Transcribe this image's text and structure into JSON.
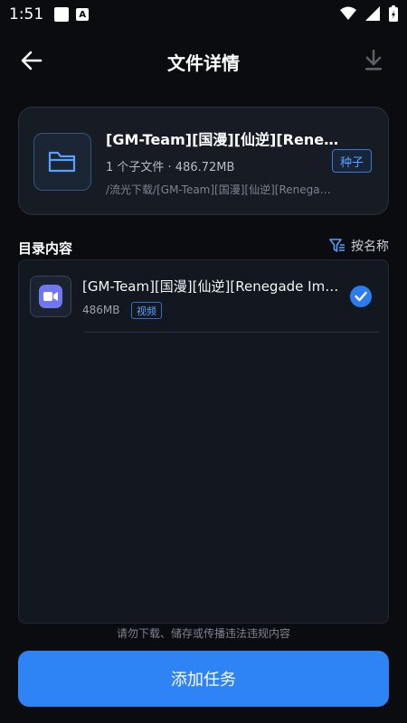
{
  "status": {
    "time": "1:51",
    "notif_letter": "A"
  },
  "header": {
    "title": "文件详情"
  },
  "file_card": {
    "title": "[GM-Team][国漫][仙逆][Renegade Immortal]",
    "meta": "1 个子文件 · 486.72MB",
    "path": "/流光下载/[GM-Team][国漫][仙逆][Renegade Immortal]",
    "badge": "种子",
    "icon": "folder-icon"
  },
  "section": {
    "title": "目录内容",
    "sort_label": "按名称",
    "sort_icon": "filter-sort-icon"
  },
  "files": [
    {
      "title": "[GM-Team][国漫][仙逆][Renegade Immortal]",
      "size": "486MB",
      "tag": "视频",
      "icon": "video-icon",
      "checked": true
    }
  ],
  "notice": "请勿下载、储存或传播违法违规内容",
  "actions": {
    "add_task": "添加任务"
  },
  "colors": {
    "accent": "#2e83f5",
    "background": "#0b0c10",
    "card": "#161b24",
    "video_icon": "#6f78f2"
  }
}
